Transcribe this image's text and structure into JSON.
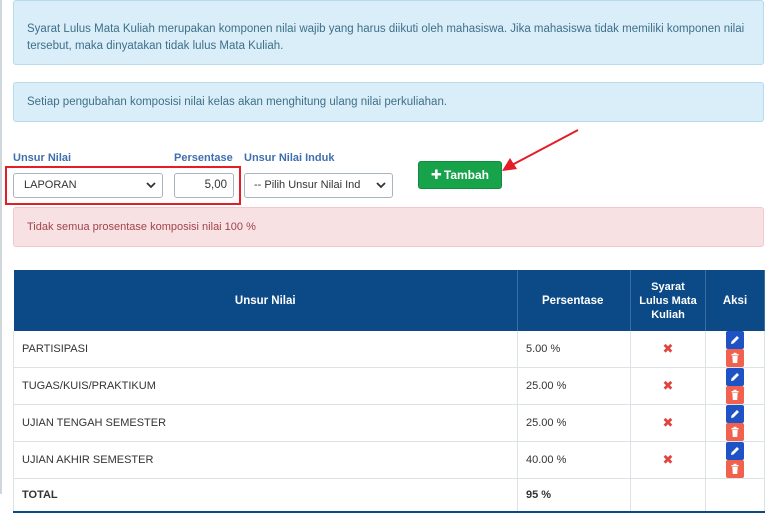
{
  "info_notice_1": "Syarat Lulus Mata Kuliah merupakan komponen nilai wajib yang harus diikuti oleh mahasiswa. Jika mahasiswa tidak memiliki komponen nilai tersebut, maka dinyatakan tidak lulus Mata Kuliah.",
  "info_notice_2": "Setiap pengubahan komposisi nilai kelas akan menghitung ulang nilai perkuliahan.",
  "form": {
    "unsur_nilai_label": "Unsur Nilai",
    "unsur_nilai_value": "LAPORAN",
    "persentase_label": "Persentase",
    "persentase_value": "5,00",
    "induk_label": "Unsur Nilai Induk",
    "induk_value": "-- Pilih Unsur Nilai Ind",
    "add_button": "Tambah"
  },
  "warning": "Tidak semua prosentase komposisi nilai 100 %",
  "table": {
    "headers": {
      "unsur": "Unsur Nilai",
      "persentase": "Persentase",
      "syarat_1": "Syarat",
      "syarat_2": "Lulus Mata",
      "syarat_3": "Kuliah",
      "aksi": "Aksi"
    },
    "rows": [
      {
        "name": "PARTISIPASI",
        "pct": "5.00 %"
      },
      {
        "name": "TUGAS/KUIS/PRAKTIKUM",
        "pct": "25.00 %"
      },
      {
        "name": "UJIAN TENGAH SEMESTER",
        "pct": "25.00 %"
      },
      {
        "name": "UJIAN AKHIR SEMESTER",
        "pct": "40.00 %"
      }
    ],
    "total_label": "TOTAL",
    "total_value": "95 %"
  },
  "colors": {
    "header_bg": "#0c4a87",
    "add_button": "#17a34a",
    "edit_button": "#1f53c5",
    "delete_button": "#f0624d",
    "highlight": "#e41e26"
  },
  "icons": {
    "add": "plus-icon",
    "edit": "pencil-icon",
    "delete": "trash-icon",
    "not_required": "x-mark-icon"
  }
}
